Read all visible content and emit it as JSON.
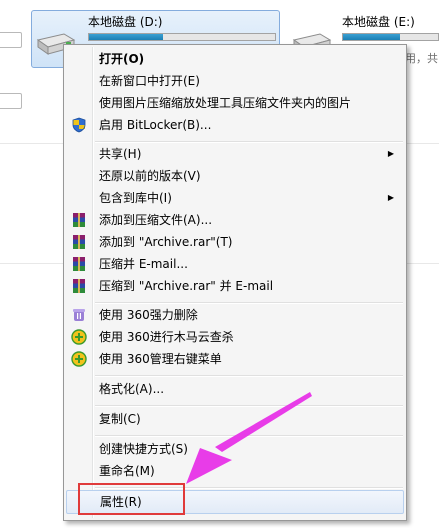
{
  "drives": [
    {
      "label": "本地磁盘 (D:)"
    },
    {
      "label": "本地磁盘 (E:)"
    }
  ],
  "background_text": {
    "fragment": "用，共"
  },
  "menu": {
    "items": [
      {
        "label": "打开(O)",
        "bold": true,
        "icon": ""
      },
      {
        "label": "在新窗口中打开(E)",
        "icon": ""
      },
      {
        "label": "使用图片压缩缩放处理工具压缩文件夹内的图片",
        "icon": ""
      },
      {
        "label": "启用 BitLocker(B)...",
        "icon": "shield-icon"
      },
      {
        "label": "共享(H)",
        "submenu": true,
        "icon": ""
      },
      {
        "label": "还原以前的版本(V)",
        "icon": ""
      },
      {
        "label": "包含到库中(I)",
        "submenu": true,
        "icon": ""
      },
      {
        "label": "添加到压缩文件(A)...",
        "icon": "winrar-icon"
      },
      {
        "label": "添加到 \"Archive.rar\"(T)",
        "icon": "winrar-icon"
      },
      {
        "label": "压缩并 E-mail...",
        "icon": "winrar-icon"
      },
      {
        "label": "压缩到 \"Archive.rar\" 并 E-mail",
        "icon": "winrar-icon"
      },
      {
        "label": "使用 360强力删除",
        "icon": "360-delete-icon"
      },
      {
        "label": "使用 360进行木马云查杀",
        "icon": "360-scan-icon"
      },
      {
        "label": "使用 360管理右键菜单",
        "icon": "360-menu-icon"
      },
      {
        "label": "格式化(A)...",
        "icon": ""
      },
      {
        "label": "复制(C)",
        "icon": ""
      },
      {
        "label": "创建快捷方式(S)",
        "icon": ""
      },
      {
        "label": "重命名(M)",
        "icon": ""
      },
      {
        "label": "属性(R)",
        "icon": "",
        "highlighted": true
      }
    ]
  },
  "colors": {
    "annotation_box": "#e03a3a",
    "annotation_arrow": "#e83ce8"
  }
}
